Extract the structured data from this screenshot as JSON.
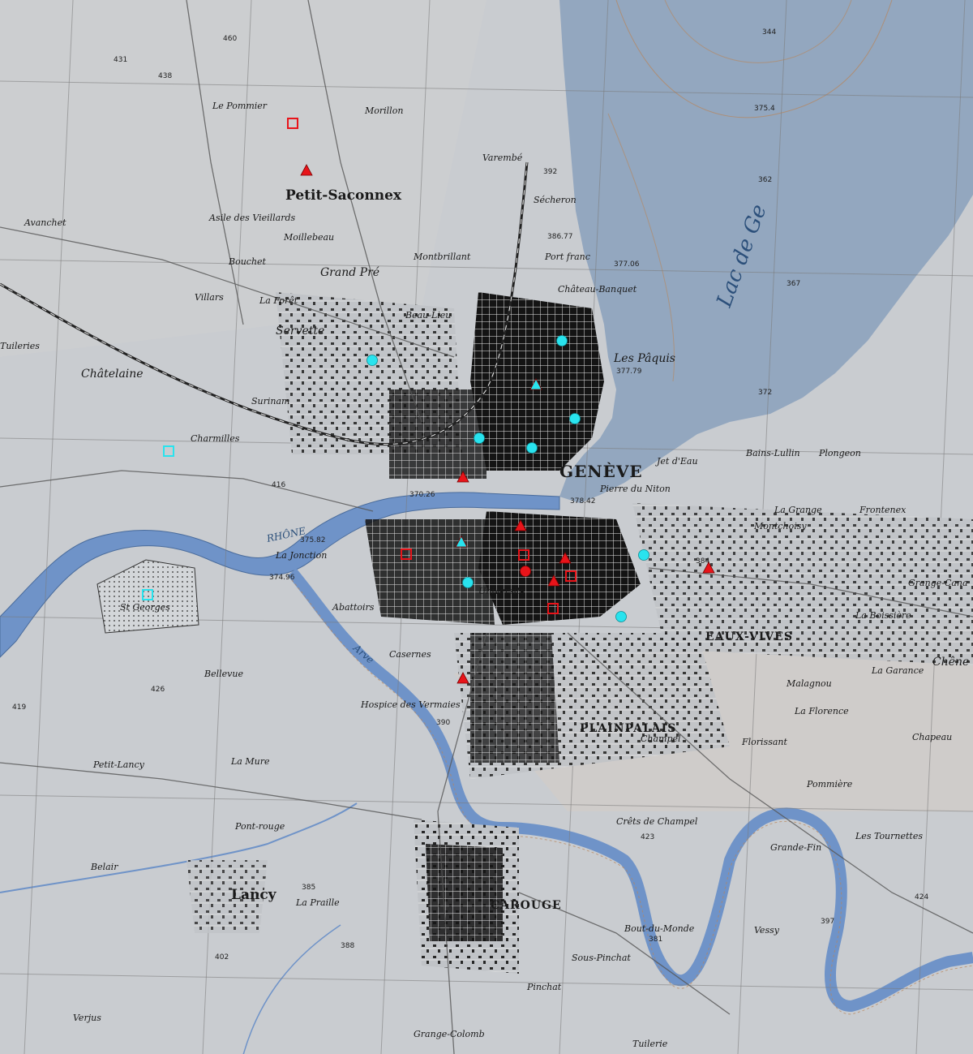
{
  "colors": {
    "land": "#c9ccd0",
    "lake": "#93a7bf",
    "river": "#6f93c8",
    "city_block": "#141414",
    "road": "#f2f2f2",
    "marker_red": "#e8141a",
    "marker_cyan": "#29e3ee",
    "contour": "#b8855a"
  },
  "labels": {
    "geneve": "GENÈVE",
    "plainpalais": "PLAINPALAIS",
    "eaux_vives": "EAUX-VIVES",
    "carouge": "CAROUGE",
    "petit_saconnex": "Petit-Saconnex",
    "lancy": "Lancy",
    "grand_pre": "Grand Pré",
    "les_paquis": "Les Pâquis",
    "servette": "Servette",
    "chatelaine": "Châtelaine",
    "charmilles": "Charmilles",
    "surinam": "Surinam",
    "petit_lancy": "Petit-Lancy",
    "st_georges": "St Georges",
    "la_jonction": "La Jonction",
    "abattoirs": "Abattoirs",
    "casernes": "Casernes",
    "champel": "Champel",
    "florissant": "Florissant",
    "malagnou": "Malagnou",
    "la_grange": "La Grange",
    "frontenex": "Frontenex",
    "plongeon": "Plongeon",
    "montchoisy": "Montchoisy",
    "bout_du_monde": "Bout-du-Monde",
    "vessy": "Vessy",
    "pinchat": "Pinchat",
    "la_praille": "La Praille",
    "secheron": "Sécheron",
    "varembe": "Varembé",
    "le_pommier": "Le Pommier",
    "morillon": "Morillon",
    "moillebeau": "Moillebeau",
    "montbrillant": "Montbrillant",
    "port_franc": "Port franc",
    "chateau_banquet": "Château-Banquet",
    "beau_lieu": "Beau-Lieu",
    "asile": "Asile des Vieillards",
    "la_forct": "La Forêt",
    "bouchet": "Bouchet",
    "villars": "Villars",
    "avanchet": "Avanchet",
    "tuileries": "Tuileries",
    "pierre_niton": "Pierre du Niton",
    "jet_deau": "Jet d'Eau",
    "crets_champel": "Crêts de Champel",
    "grange_canal": "Grange-Cana",
    "la_boissiere": "La Boissière",
    "rhone": "RHÔNE",
    "arve": "Arve",
    "lac": "Lac de Ge",
    "universite": "Université",
    "bains_lullin": "Bains-Lullin",
    "chene": "Chêne",
    "hospice": "Hospice des Vermaies",
    "bellevue": "Bellevue",
    "pont_rouge": "Pont-rouge",
    "les_tournettes": "Les Tournettes",
    "pommiere": "Pommière",
    "la_florence": "La Florence",
    "la_garance": "La Garance",
    "chapeau": "Chapeau",
    "belair": "Belair",
    "verjus": "Verjus",
    "tuilerie": "Tuilerie",
    "grange_colomb": "Grange-Colomb",
    "sous_pinchat": "Sous-Pinchat",
    "grande_fin": "Grande-Fin",
    "la_mure": "La Mure"
  },
  "elevations": {
    "e1": "375.4",
    "e2": "344",
    "e3": "362",
    "e4": "367",
    "e5": "372",
    "e6": "386.77",
    "e7": "377.06",
    "e8": "377.79",
    "e9": "378.42",
    "e10": "374.96",
    "e11": "375.82",
    "e12": "370.26",
    "e13": "423",
    "e14": "416",
    "e15": "460",
    "e16": "431",
    "e17": "384",
    "e18": "388",
    "e19": "392",
    "e20": "390",
    "e21": "381",
    "e22": "397",
    "e23": "424",
    "e24": "402",
    "e25": "385",
    "e26": "419",
    "e27": "426",
    "e28": "438"
  },
  "markers": [
    {
      "kind": "triangle",
      "color": "red",
      "label": "site-petit-saconnex"
    },
    {
      "kind": "square",
      "color": "red",
      "label": "site-la-solitude"
    },
    {
      "kind": "triangle",
      "color": "red",
      "label": "site-coulouvreniere"
    },
    {
      "kind": "triangle",
      "color": "red",
      "label": "site-old-town-1"
    },
    {
      "kind": "square",
      "color": "red",
      "label": "site-old-town-2"
    },
    {
      "kind": "circle",
      "color": "red",
      "label": "site-old-town-3"
    },
    {
      "kind": "triangle",
      "color": "red",
      "label": "site-old-town-4"
    },
    {
      "kind": "triangle",
      "color": "red",
      "label": "site-old-town-5"
    },
    {
      "kind": "square",
      "color": "red",
      "label": "site-old-town-6"
    },
    {
      "kind": "square",
      "color": "red",
      "label": "site-old-town-7"
    },
    {
      "kind": "triangle",
      "color": "red",
      "label": "site-eaux-vives"
    },
    {
      "kind": "triangle",
      "color": "red",
      "label": "site-plainpalais"
    },
    {
      "kind": "square",
      "color": "red",
      "label": "site-jonction"
    },
    {
      "kind": "square",
      "color": "cyan",
      "label": "site-charmilles"
    },
    {
      "kind": "square",
      "color": "cyan",
      "label": "site-st-georges"
    },
    {
      "kind": "circle",
      "color": "cyan",
      "label": "site-servette"
    },
    {
      "kind": "circle",
      "color": "cyan",
      "label": "site-paquis-1"
    },
    {
      "kind": "triangle",
      "color": "cyan",
      "label": "site-paquis-2"
    },
    {
      "kind": "circle",
      "color": "cyan",
      "label": "site-paquis-3"
    },
    {
      "kind": "circle",
      "color": "cyan",
      "label": "site-cornavin"
    },
    {
      "kind": "circle",
      "color": "cyan",
      "label": "site-rive-droite"
    },
    {
      "kind": "circle",
      "color": "cyan",
      "label": "site-plainpalais-1"
    },
    {
      "kind": "triangle",
      "color": "cyan",
      "label": "site-plainpalais-2"
    },
    {
      "kind": "circle",
      "color": "cyan",
      "label": "site-rive"
    },
    {
      "kind": "circle",
      "color": "cyan",
      "label": "site-tranchees"
    }
  ]
}
